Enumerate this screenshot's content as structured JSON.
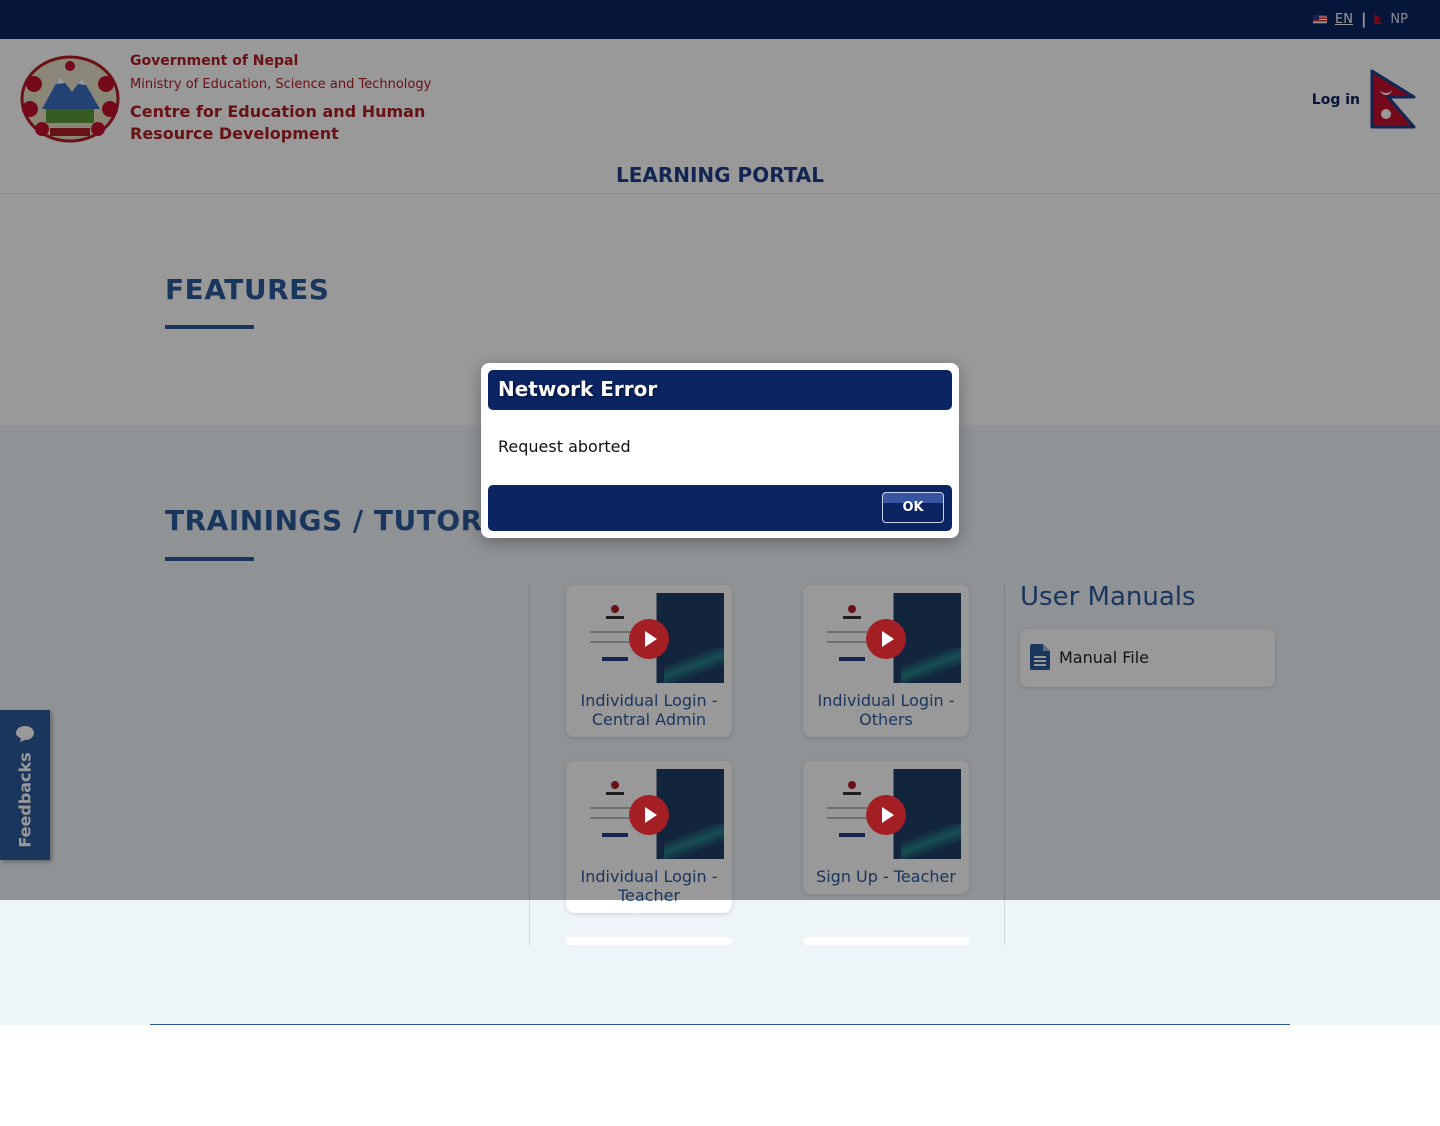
{
  "language": {
    "en": "EN",
    "np": "NP"
  },
  "header": {
    "gov_line1": "Government of Nepal",
    "gov_line2": "Ministry of Education, Science and Technology",
    "gov_line3": "Centre for Education and Human Resource Development",
    "login": "Log in",
    "portal_title": "LEARNING PORTAL"
  },
  "features": {
    "title": "FEATURES"
  },
  "trainings": {
    "title": "TRAININGS / TUTORIALS",
    "videos": [
      {
        "label": "Individual Login - Central Admin"
      },
      {
        "label": "Individual Login - Others"
      },
      {
        "label": "Individual Login - Teacher"
      },
      {
        "label": "Sign Up - Teacher"
      }
    ]
  },
  "manuals": {
    "title": "User Manuals",
    "items": [
      {
        "label": "Manual File",
        "icon": "file-icon"
      }
    ]
  },
  "feedback": {
    "label": "Feedbacks"
  },
  "modal": {
    "title": "Network Error",
    "message": "Request aborted",
    "ok_label": "OK"
  },
  "colors": {
    "navy": "#0b2462",
    "accent_blue": "#2d5b9c",
    "gov_red": "#b01e24",
    "play_red": "#a31f24"
  }
}
